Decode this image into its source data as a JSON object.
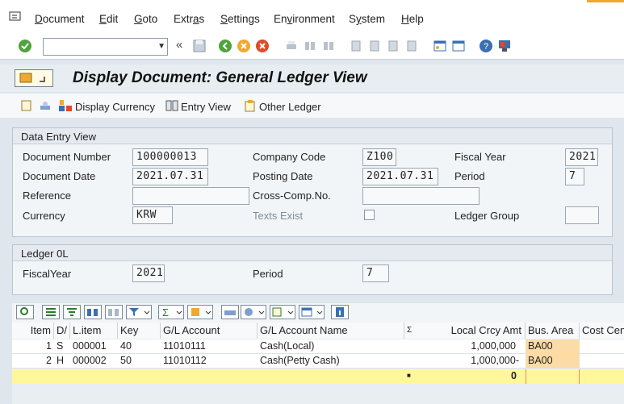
{
  "menu": [
    {
      "label": "Document",
      "ul": "D"
    },
    {
      "label": "Edit",
      "ul": "E"
    },
    {
      "label": "Goto",
      "ul": "G"
    },
    {
      "label": "Extras",
      "ul": "a"
    },
    {
      "label": "Settings",
      "ul": "S"
    },
    {
      "label": "Environment",
      "ul": "v"
    },
    {
      "label": "System",
      "ul": "y"
    },
    {
      "label": "Help",
      "ul": "H"
    }
  ],
  "toolbar": {
    "command_value": "",
    "back_glyph": "«"
  },
  "title": "Display Document: General Ledger View",
  "app_toolbar": {
    "display_currency": "Display Currency",
    "entry_view": "Entry View",
    "other_ledger": "Other Ledger"
  },
  "data_entry_view": {
    "heading": "Data Entry View",
    "document_number_label": "Document Number",
    "document_number": "100000013",
    "company_code_label": "Company Code",
    "company_code": "Z100",
    "fiscal_year_label": "Fiscal Year",
    "fiscal_year": "2021",
    "document_date_label": "Document Date",
    "document_date": "2021.07.31",
    "posting_date_label": "Posting Date",
    "posting_date": "2021.07.31",
    "period_label": "Period",
    "period": "7",
    "reference_label": "Reference",
    "reference": "",
    "cross_comp_label": "Cross-Comp.No.",
    "cross_comp": "",
    "currency_label": "Currency",
    "currency": "KRW",
    "texts_exist_label": "Texts Exist",
    "ledger_group_label": "Ledger Group",
    "ledger_group": ""
  },
  "ledger": {
    "heading": "Ledger 0L",
    "fiscal_year_label": "FiscalYear",
    "fiscal_year": "2021",
    "period_label": "Period",
    "period": "7"
  },
  "grid": {
    "columns": [
      "Item",
      "D/",
      "L.item",
      "Key",
      "G/L Account",
      "G/L Account Name",
      "Σ",
      "Local Crcy Amt",
      "Bus. Area",
      "Cost Cent"
    ],
    "rows": [
      {
        "item": "1",
        "dc": "S",
        "litem": "000001",
        "key": "40",
        "account": "11010111",
        "name": "Cash(Local)",
        "amount": "1,000,000",
        "busarea": "BA00"
      },
      {
        "item": "2",
        "dc": "H",
        "litem": "000002",
        "key": "50",
        "account": "11010112",
        "name": "Cash(Petty Cash)",
        "amount": "1,000,000-",
        "busarea": "BA00"
      }
    ],
    "total_marker": "■",
    "total_amount": "0"
  },
  "colors": {
    "accent_orange": "#f0a830",
    "total_yellow": "#fff79a",
    "busarea_highlight": "#fbdca7"
  }
}
